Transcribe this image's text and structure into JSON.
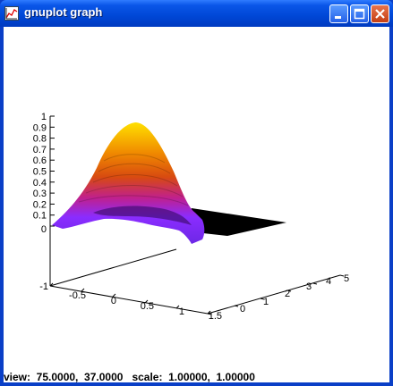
{
  "window": {
    "title": "gnuplot graph",
    "icon": "gnuplot-graph-icon",
    "buttons": [
      "minimize",
      "maximize",
      "close"
    ]
  },
  "status": {
    "text": "view:  75.0000,  37.0000   scale:  1.00000,  1.00000"
  },
  "chart_data": {
    "type": "surface",
    "z_ticks": [
      "1",
      "0.9",
      "0.8",
      "0.7",
      "0.6",
      "0.5",
      "0.4",
      "0.3",
      "0.2",
      "0.1",
      "0"
    ],
    "x_ticks": [
      "-1",
      "-0.5",
      "0",
      "0.5",
      "1",
      "1.5"
    ],
    "y_ticks": [
      "0",
      "1",
      "2",
      "3",
      "4",
      "5"
    ],
    "xlim": [
      -1,
      1.5
    ],
    "ylim": [
      0,
      5
    ],
    "zlim": [
      0,
      1
    ],
    "view": [
      75,
      37
    ],
    "colormap": [
      "#000000",
      "#7b2cff",
      "#c01a8a",
      "#e05a00",
      "#ffd000"
    ]
  }
}
